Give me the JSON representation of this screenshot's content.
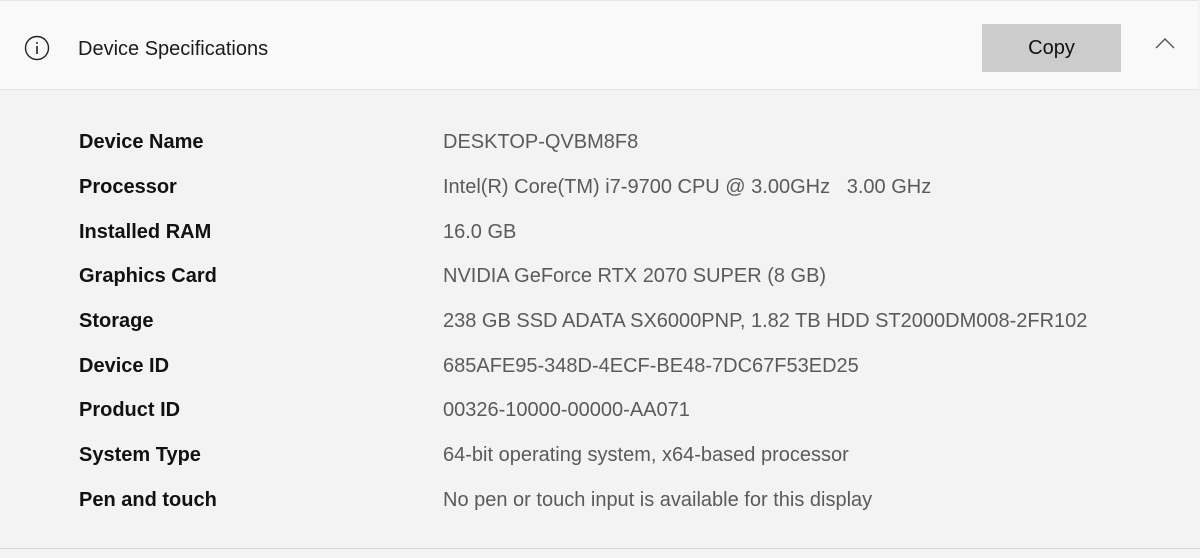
{
  "header": {
    "title": "Device Specifications",
    "copy_label": "Copy"
  },
  "specs": [
    {
      "label": "Device Name",
      "value": "DESKTOP-QVBM8F8"
    },
    {
      "label": "Processor",
      "value": "Intel(R) Core(TM) i7-9700 CPU @ 3.00GHz   3.00 GHz"
    },
    {
      "label": "Installed RAM",
      "value": "16.0 GB"
    },
    {
      "label": "Graphics Card",
      "value": "NVIDIA GeForce RTX 2070 SUPER (8 GB)"
    },
    {
      "label": "Storage",
      "value": "238 GB SSD ADATA SX6000PNP, 1.82 TB HDD ST2000DM008-2FR102"
    },
    {
      "label": "Device ID",
      "value": "685AFE95-348D-4ECF-BE48-7DC67F53ED25"
    },
    {
      "label": "Product ID",
      "value": "00326-10000-00000-AA071"
    },
    {
      "label": "System Type",
      "value": "64-bit operating system, x64-based processor"
    },
    {
      "label": "Pen and touch",
      "value": "No pen or touch input is available for this display"
    }
  ],
  "icons": {
    "info": "info-icon",
    "collapse": "chevron-up-icon"
  }
}
